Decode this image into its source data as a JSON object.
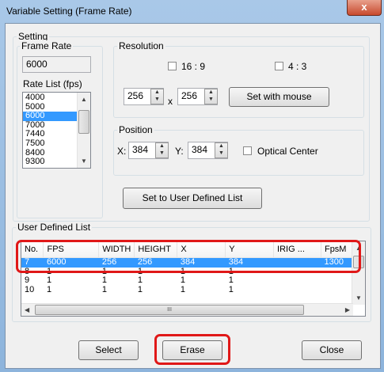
{
  "window": {
    "title": "Variable Setting (Frame Rate)",
    "close_glyph": "x"
  },
  "setting": {
    "group_label": "Setting",
    "frame_rate": {
      "label": "Frame Rate",
      "value": "6000",
      "rate_list_label": "Rate List (fps)",
      "items": [
        "4000",
        "5000",
        "6000",
        "7000",
        "7440",
        "7500",
        "8400",
        "9300"
      ],
      "selected": "6000"
    },
    "resolution": {
      "label": "Resolution",
      "ratio_16_9": "16 : 9",
      "ratio_4_3": "4 : 3",
      "width": "256",
      "x_sep": "x",
      "height": "256",
      "set_with_mouse": "Set with mouse"
    },
    "position": {
      "label": "Position",
      "x_label": "X:",
      "x_value": "384",
      "y_label": "Y:",
      "y_value": "384",
      "optical_center": "Optical Center"
    },
    "set_user_list_button": "Set to User Defined List"
  },
  "user_list": {
    "label": "User Defined List",
    "columns": [
      "No.",
      "FPS",
      "WIDTH",
      "HEIGHT",
      "X",
      "Y",
      "IRIG ...",
      "FpsM"
    ],
    "rows": [
      [
        "7",
        "6000",
        "256",
        "256",
        "384",
        "384",
        "",
        "1300"
      ],
      [
        "8",
        "1",
        "1",
        "1",
        "1",
        "1",
        "",
        ""
      ],
      [
        "9",
        "1",
        "1",
        "1",
        "1",
        "1",
        "",
        ""
      ],
      [
        "10",
        "1",
        "1",
        "1",
        "1",
        "1",
        "",
        ""
      ]
    ],
    "selected_row": 0,
    "hscroll_grip": "III"
  },
  "buttons": {
    "select": "Select",
    "erase": "Erase",
    "close": "Close"
  },
  "colors": {
    "selection": "#3399ff",
    "highlight": "#e01818"
  }
}
